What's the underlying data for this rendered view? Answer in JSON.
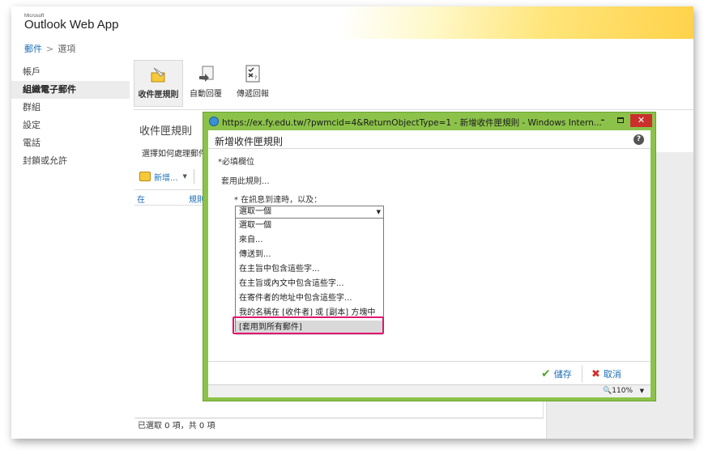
{
  "app": {
    "vendor_tag": "Microsoft",
    "name": "Outlook Web App"
  },
  "breadcrumb": {
    "parent": "郵件",
    "separator": ">",
    "current": "選項"
  },
  "left_nav": {
    "items": [
      {
        "label": "帳戶"
      },
      {
        "label": "組織電子郵件",
        "selected": true
      },
      {
        "label": "群組"
      },
      {
        "label": "設定"
      },
      {
        "label": "電話"
      },
      {
        "label": "封鎖或允許"
      }
    ]
  },
  "ribbon": {
    "inbox_rules": "收件匣規則",
    "auto_reply": "自動回覆",
    "delivery_reports": "傳遞回報"
  },
  "content": {
    "title": "收件匣規則",
    "description": "選擇如何處理郵件",
    "new_button": "新增...",
    "column_on": "在",
    "column_rule": "規則",
    "status": "已選取 0 項，共 0 項"
  },
  "dialog": {
    "window_title": "https://ex.fy.edu.tw/?pwmcid=4&ReturnObjectType=1 - 新增收件匣規則 - Windows Intern...",
    "title": "新增收件匣規則",
    "required_note": "*必填欄位",
    "apply_rule": "套用此規則...",
    "condition_label": "* 在訊息到達時，以及：",
    "select_value": "選取一個",
    "options": [
      "選取一個",
      "來自...",
      "傳送到...",
      "在主旨中包含這些字...",
      "在主旨或內文中包含這些字...",
      "在寄件者的地址中包含這些字...",
      "我的名稱在 [收件者] 或 [副本] 方塊中",
      "[套用到所有郵件]"
    ],
    "highlighted_option_index": 7,
    "save": "儲存",
    "cancel": "取消",
    "zoom": "110%"
  },
  "colors": {
    "accent_link": "#1d6fb8",
    "dialog_frame": "#8cc24a",
    "highlight_box": "#e0166e",
    "close_button": "#c9302c"
  }
}
